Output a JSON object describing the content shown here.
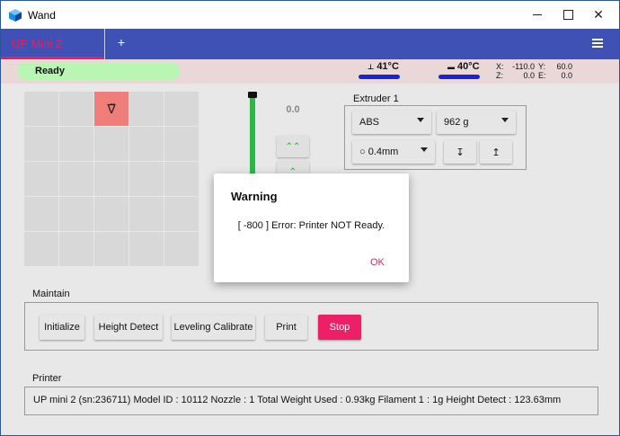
{
  "window": {
    "title": "Wand"
  },
  "tabs": {
    "active_label": "UP Mini 2",
    "add_label": "+"
  },
  "status": {
    "state": "Ready",
    "temp_nozzle": "41°C",
    "temp_bed": "40°C",
    "coords": {
      "x_label": "X:",
      "x": "-110.0",
      "y_label": "Y:",
      "y": "60.0",
      "z_label": "Z:",
      "z": "0.0",
      "e_label": "E:",
      "e": "0.0"
    }
  },
  "movement": {
    "head_glyph": "∇̈",
    "z_value": "0.0",
    "z_up_fast_icon": "⌃⌃",
    "z_up_icon": "⌃"
  },
  "extruder": {
    "title": "Extruder 1",
    "material": "ABS",
    "weight": "962 g",
    "nozzle": "○ 0.4mm",
    "extrude_icon": "↧",
    "retract_icon": "↥"
  },
  "maintain": {
    "title": "Maintain",
    "initialize": "Initialize",
    "height_detect": "Height Detect",
    "leveling": "Leveling Calibrate",
    "print": "Print",
    "stop": "Stop"
  },
  "printer": {
    "title": "Printer",
    "info": "UP mini 2 (sn:236711)   Model ID : 10112   Nozzle : 1   Total Weight Used : 0.93kg   Filament 1 : 1g   Height Detect : 123.63mm"
  },
  "dialog": {
    "title": "Warning",
    "message": "[ -800 ] Error: Printer NOT Ready.",
    "ok": "OK"
  },
  "colors": {
    "accent": "#3f51b5",
    "pink": "#e91e63",
    "ready": "#b9f6b4",
    "stop": "#ee1e67",
    "green": "#2bb844"
  }
}
